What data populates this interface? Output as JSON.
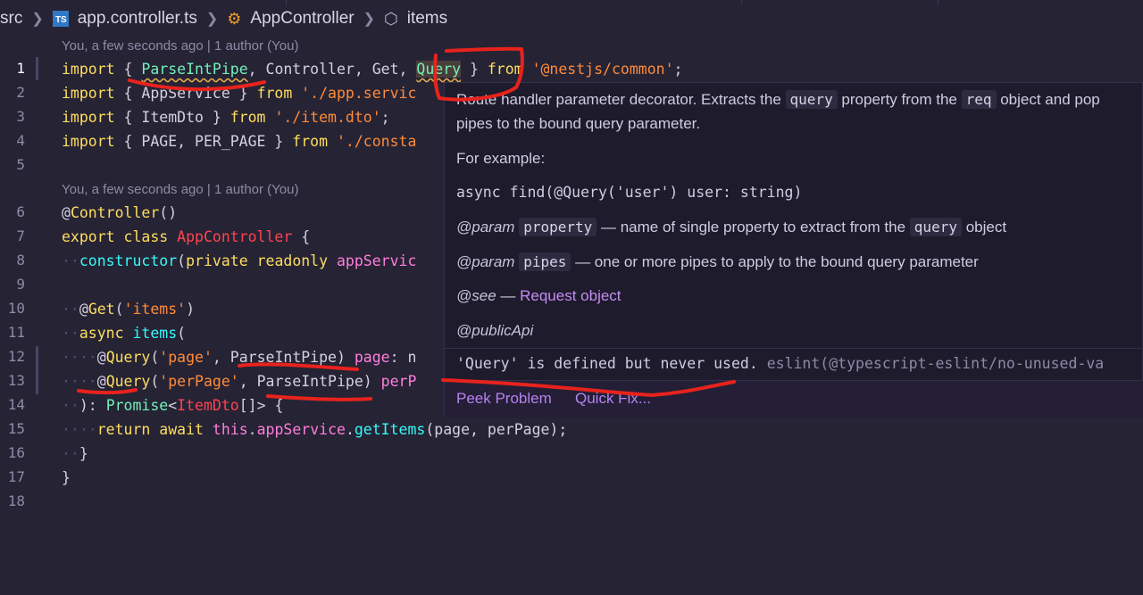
{
  "breadcrumb": {
    "root": "src",
    "file": "app.controller.ts",
    "file_badge": "TS",
    "class": "AppController",
    "member": "items"
  },
  "blame": {
    "top": "You, a few seconds ago | 1 author (You)",
    "class": "You, a few seconds ago | 1 author (You)"
  },
  "line_numbers": [
    "1",
    "2",
    "3",
    "4",
    "5",
    "6",
    "7",
    "8",
    "9",
    "10",
    "11",
    "12",
    "13",
    "14",
    "15",
    "16",
    "17",
    "18"
  ],
  "code": {
    "l1": {
      "kw1": "import",
      "p1": " { ",
      "a": "ParseIntPipe",
      "p2": ", Controller, Get, ",
      "b": "Query",
      "p3": " } ",
      "kw2": "from",
      "s": "'@nestjs/common'",
      "end": ";"
    },
    "l2": {
      "kw1": "import",
      "p1": " { AppService } ",
      "kw2": "from",
      "s": "'./app.servic"
    },
    "l3": {
      "kw1": "import",
      "p1": " { ItemDto } ",
      "kw2": "from",
      "s": "'./item.dto'",
      "end": ";"
    },
    "l4": {
      "kw1": "import",
      "p1": " { PAGE, PER_PAGE } ",
      "kw2": "from",
      "s": "'./consta"
    },
    "l6": {
      "at": "@",
      "dec": "Controller",
      "p": "()"
    },
    "l7": {
      "kw1": "export",
      "kw2": "class",
      "cls": "AppController",
      "p": " {"
    },
    "l8": {
      "fn": "constructor",
      "p1": "(",
      "kw1": "private",
      "kw2": "readonly",
      "v": "appServic"
    },
    "l10": {
      "at": "@",
      "dec": "Get",
      "p1": "(",
      "s": "'items'",
      "p2": ")"
    },
    "l11": {
      "kw": "async",
      "fn": "items",
      "p": "("
    },
    "l12": {
      "at": "@",
      "dec": "Query",
      "p1": "(",
      "s": "'page'",
      "p2": ", ",
      "cls": "ParseIntPipe",
      "p3": ") ",
      "v": "page",
      "p4": ": n"
    },
    "l13": {
      "at": "@",
      "dec": "Query",
      "p1": "(",
      "s": "'perPage'",
      "p2": ", ",
      "cls": "ParseIntPipe",
      "p3": ") ",
      "v": "perP"
    },
    "l14": {
      "p1": "): ",
      "typ": "Promise",
      "p2": "<",
      "cls": "ItemDto",
      "p3": "[]> {"
    },
    "l15": {
      "kw1": "return",
      "kw2": "await",
      "th": "this",
      "p1": ".",
      "v": "appService",
      "p2": ".",
      "fn": "getItems",
      "p3": "(page, perPage);"
    },
    "l16": {
      "p": "}"
    },
    "l17": {
      "p": "}"
    }
  },
  "hover": {
    "desc_1a": "Route handler parameter decorator. Extracts the ",
    "desc_1b": "query",
    "desc_1c": " property from the ",
    "desc_1d": "req",
    "desc_1e": " object and pop",
    "desc_2": "pipes to the bound query parameter.",
    "example_label": "For example:",
    "example_code": "async find(@Query('user') user: string)",
    "param1_tag": "@param",
    "param1_name": "property",
    "param1_desc_a": " — name of single property to extract from the ",
    "param1_code": "query",
    "param1_desc_b": " object",
    "param2_tag": "@param",
    "param2_name": "pipes",
    "param2_desc": " — one or more pipes to apply to the bound query parameter",
    "see_tag": "@see",
    "see_dash": " — ",
    "see_link": "Request object",
    "public_api": "@publicApi",
    "problem": "'Query' is defined but never used.",
    "problem_source": " eslint(@typescript-eslint/no-unused-va",
    "peek_problem": "Peek Problem",
    "quick_fix": "Quick Fix..."
  },
  "colors": {
    "background": "#262335",
    "hover_bg": "#1e1b2c",
    "annotation_red": "#e8231c",
    "link": "#b681f0"
  }
}
